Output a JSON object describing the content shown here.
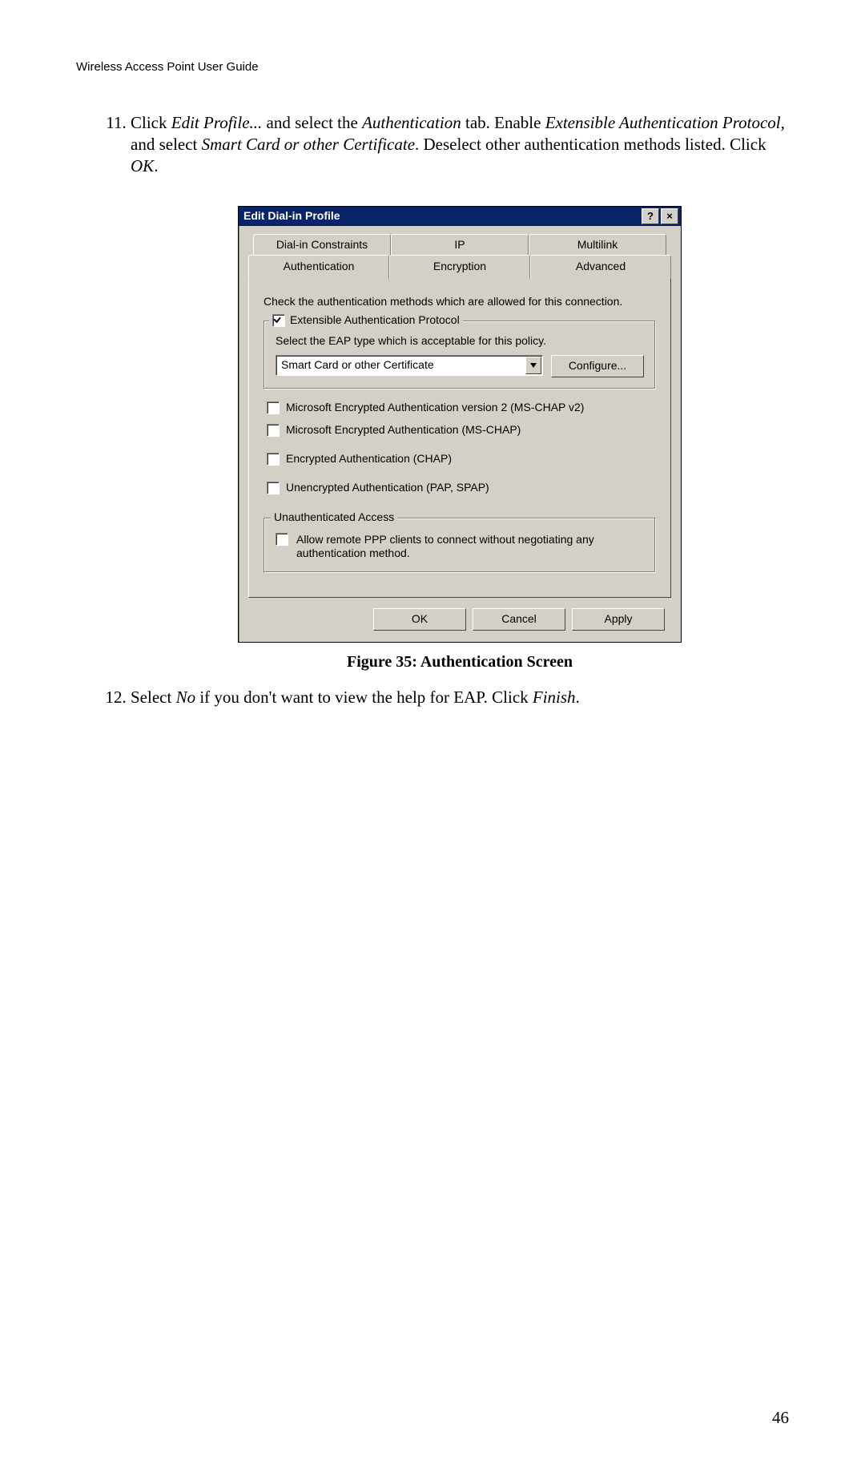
{
  "header": "Wireless Access Point User Guide",
  "list_start": 11,
  "items": [
    {
      "pre": "Click ",
      "i1": "Edit Profile...",
      "mid1": " and select the ",
      "i2": "Authentication",
      "mid2": " tab. Enable ",
      "i3": "Extensible Authentication Protocol",
      "mid3": ", and select ",
      "i4": "Smart Card or other Certificate",
      "mid4": ". Deselect other authentication methods listed. Click ",
      "i5": "OK",
      "post": "."
    },
    {
      "pre": "Select ",
      "i1": "No",
      "mid1": " if you don't want to view the help for EAP. Click ",
      "i2": "Finish",
      "post": "."
    }
  ],
  "figure_caption": "Figure 35: Authentication Screen",
  "page_number": "46",
  "dialog": {
    "title": "Edit Dial-in Profile",
    "help_btn": "?",
    "close_btn": "×",
    "tabs_back": [
      "Dial-in Constraints",
      "IP",
      "Multilink"
    ],
    "tabs_front": [
      "Authentication",
      "Encryption",
      "Advanced"
    ],
    "intro": "Check the authentication methods which are allowed for this connection.",
    "eap_group_label": "Extensible Authentication Protocol",
    "eap_subtext": "Select the EAP type which is acceptable for this policy.",
    "eap_select": "Smart Card or other Certificate",
    "configure_btn": "Configure...",
    "auth_methods": [
      "Microsoft Encrypted Authentication version 2 (MS-CHAP v2)",
      "Microsoft Encrypted Authentication (MS-CHAP)",
      "Encrypted Authentication (CHAP)",
      "Unencrypted Authentication (PAP, SPAP)"
    ],
    "unauth_title": "Unauthenticated Access",
    "unauth_msg": "Allow remote PPP clients to connect without negotiating any authentication method.",
    "ok": "OK",
    "cancel": "Cancel",
    "apply": "Apply"
  }
}
